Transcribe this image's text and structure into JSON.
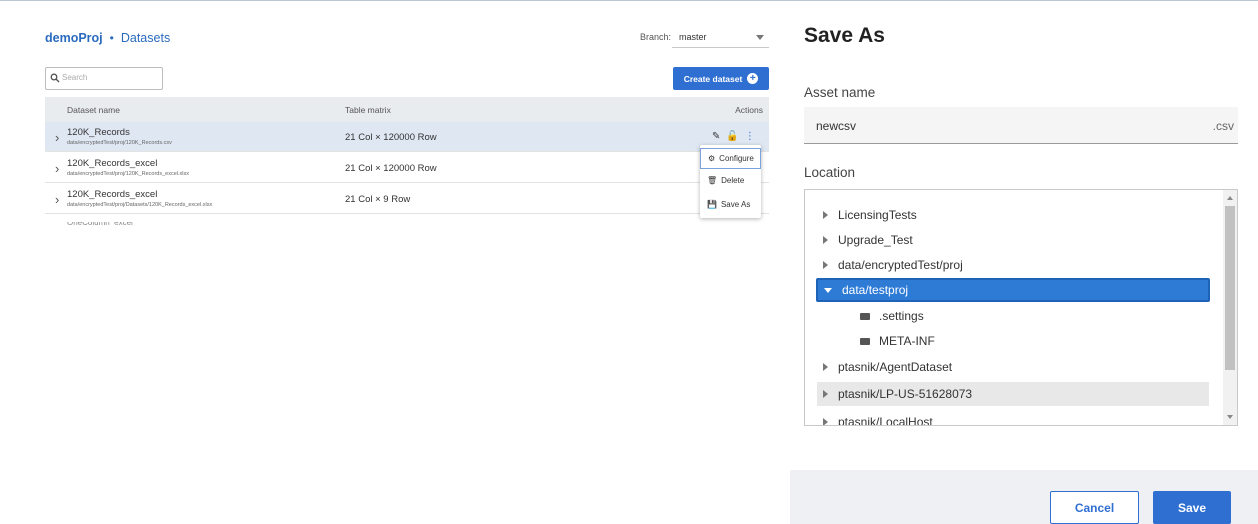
{
  "datasets_panel": {
    "breadcrumb": {
      "project": "demoProj",
      "separator": "•",
      "current": "Datasets"
    },
    "branch": {
      "label": "Branch:",
      "value": "master"
    },
    "search": {
      "placeholder": "Search"
    },
    "create_button": "Create dataset",
    "columns": {
      "name": "Dataset name",
      "matrix": "Table matrix",
      "actions": "Actions"
    },
    "rows": [
      {
        "name": "120K_Records",
        "path": "data/encryptedTest/proj/120K_Records.csv",
        "matrix": "21 Col × 120000 Row"
      },
      {
        "name": "120K_Records_excel",
        "path": "data/encryptedTest/proj/120K_Records_excel.xlsx",
        "matrix": "21 Col × 120000 Row"
      },
      {
        "name": "120K_Records_excel",
        "path": "data/encryptedTest/proj/Datasets/120K_Records_excel.xlsx",
        "matrix": "21 Col × 9 Row"
      }
    ],
    "partial_row": "OneColumn_excel",
    "context_menu": [
      "Configure",
      "Delete",
      "Save As"
    ]
  },
  "save_as": {
    "title": "Save As",
    "asset_name_label": "Asset name",
    "asset_name_value": "newcsv",
    "extension": ".csv",
    "location_label": "Location",
    "tree": [
      {
        "label": "LicensingTests",
        "kind": "collapsed"
      },
      {
        "label": "Upgrade_Test",
        "kind": "collapsed"
      },
      {
        "label": "data/encryptedTest/proj",
        "kind": "collapsed"
      },
      {
        "label": "data/testproj",
        "kind": "expanded-selected"
      },
      {
        "label": ".settings",
        "kind": "folder"
      },
      {
        "label": "META-INF",
        "kind": "folder"
      },
      {
        "label": "ptasnik/AgentDataset",
        "kind": "collapsed"
      },
      {
        "label": "ptasnik/LP-US-51628073",
        "kind": "collapsed-hover"
      },
      {
        "label": "ptasnik/LocalHost",
        "kind": "collapsed"
      }
    ],
    "cancel": "Cancel",
    "save": "Save"
  },
  "colors": {
    "accent": "#2f6fd1",
    "selected_tree": "#2e7bd6",
    "selected_row": "#dfe7f3"
  }
}
